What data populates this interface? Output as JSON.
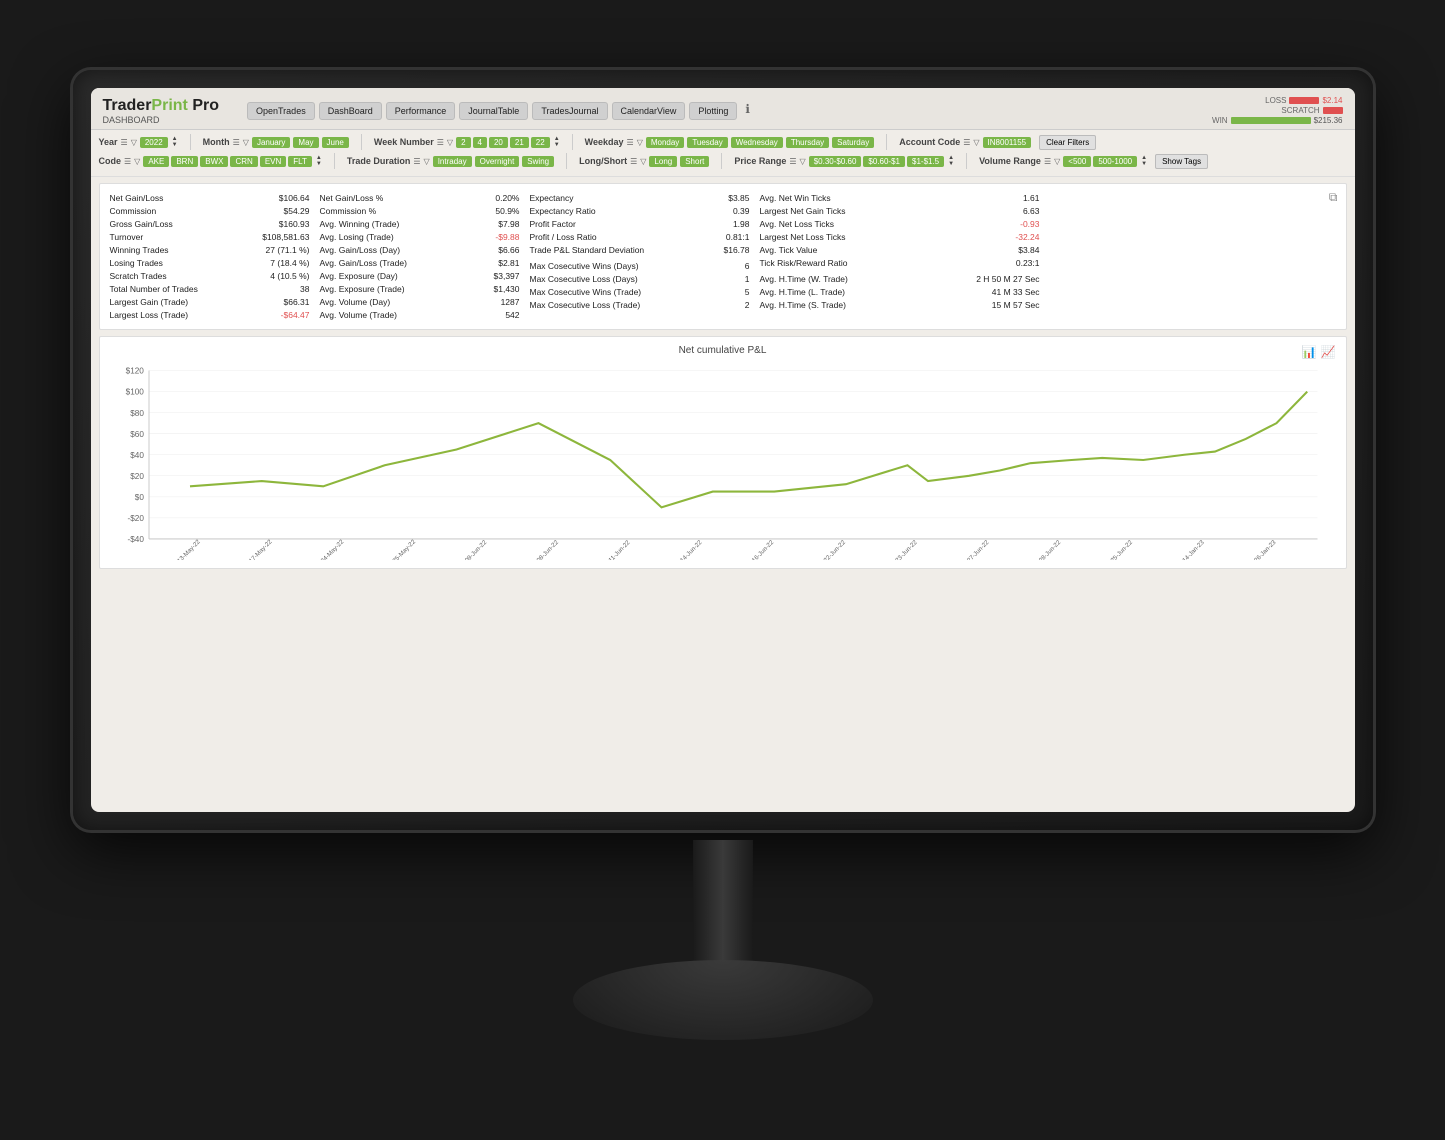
{
  "app": {
    "title": "DASHBOARD",
    "logo": {
      "trader": "Trader",
      "print": "Print",
      "pro": " Pro"
    }
  },
  "nav": {
    "buttons": [
      "OpenTrades",
      "DashBoard",
      "Performance",
      "JournalTable",
      "TradesJournal",
      "CalendarView",
      "Plotting"
    ]
  },
  "lsw": {
    "loss_label": "LOSS",
    "scratch_label": "SCRATCH",
    "win_label": "WIN",
    "loss_value": "$2.14",
    "win_value": "$215.36"
  },
  "filters": {
    "year_label": "Year",
    "year_value": "2022",
    "month_label": "Month",
    "months": [
      "January",
      "May",
      "June"
    ],
    "week_label": "Week Number",
    "weeks": [
      "2",
      "4",
      "20",
      "21",
      "22"
    ],
    "weekday_label": "Weekday",
    "weekdays": [
      "Monday",
      "Tuesday",
      "Wednesday",
      "Thursday",
      "Saturday"
    ],
    "account_label": "Account Code",
    "account_value": "IN8001155",
    "clear_label": "Clear Filters",
    "code_label": "Code",
    "codes": [
      "AKE",
      "BRN",
      "BWX",
      "CRN",
      "EVN",
      "FLT"
    ],
    "trade_duration_label": "Trade Duration",
    "durations": [
      "Intraday",
      "Overnight",
      "Swing"
    ],
    "long_short_label": "Long/Short",
    "directions": [
      "Long",
      "Short"
    ],
    "price_range_label": "Price Range",
    "price_ranges": [
      "$0.30-$0.60",
      "$0.60-$1",
      "$1-$1.5"
    ],
    "volume_range_label": "Volume Range",
    "volumes": [
      "<500",
      "500-1000"
    ],
    "show_tags_label": "Show Tags"
  },
  "stats": {
    "col1": [
      {
        "label": "Net Gain/Loss",
        "value": "$106.64",
        "red": false
      },
      {
        "label": "Commission",
        "value": "$54.29",
        "red": false
      },
      {
        "label": "Gross Gain/Loss",
        "value": "$160.93",
        "red": false
      },
      {
        "label": "Turnover",
        "value": "$108,581.63",
        "red": false
      },
      {
        "label": "Winning Trades",
        "value": "27 (71.1 %)",
        "red": false
      },
      {
        "label": "Losing Trades",
        "value": "7 (18.4 %)",
        "red": false
      },
      {
        "label": "Scratch Trades",
        "value": "4 (10.5 %)",
        "red": false
      },
      {
        "label": "Total Number of Trades",
        "value": "38",
        "red": false
      },
      {
        "label": "Largest Gain (Trade)",
        "value": "$66.31",
        "red": false
      },
      {
        "label": "Largest Loss (Trade)",
        "value": "-$64.47",
        "red": true
      }
    ],
    "col2": [
      {
        "label": "Net Gain/Loss %",
        "value": "0.20%",
        "red": false
      },
      {
        "label": "Commission %",
        "value": "50.9%",
        "red": false
      },
      {
        "label": "Avg. Winning (Trade)",
        "value": "$7.98",
        "red": false
      },
      {
        "label": "Avg. Losing (Trade)",
        "value": "-$9.88",
        "red": true
      },
      {
        "label": "Avg. Gain/Loss (Day)",
        "value": "$6.66",
        "red": false
      },
      {
        "label": "Avg. Gain/Loss (Trade)",
        "value": "$2.81",
        "red": false
      },
      {
        "label": "Avg. Exposure (Day)",
        "value": "$3,397",
        "red": false
      },
      {
        "label": "Avg. Exposure (Trade)",
        "value": "$1,430",
        "red": false
      },
      {
        "label": "Avg. Volume (Day)",
        "value": "1287",
        "red": false
      },
      {
        "label": "Avg. Volume (Trade)",
        "value": "542",
        "red": false
      }
    ],
    "col3": [
      {
        "label": "Expectancy",
        "value": "$3.85",
        "red": false
      },
      {
        "label": "Expectancy Ratio",
        "value": "0.39",
        "red": false
      },
      {
        "label": "Profit Factor",
        "value": "1.98",
        "red": false
      },
      {
        "label": "Profit / Loss Ratio",
        "value": "0.81:1",
        "red": false
      },
      {
        "label": "Trade P&L Standard Deviation",
        "value": "$16.78",
        "red": false
      },
      {
        "label": "",
        "value": "",
        "red": false
      },
      {
        "label": "Max Cosecutive Wins (Days)",
        "value": "6",
        "red": false
      },
      {
        "label": "Max Cosecutive Loss (Days)",
        "value": "1",
        "red": false
      },
      {
        "label": "Max Cosecutive Wins (Trade)",
        "value": "5",
        "red": false
      },
      {
        "label": "Max Cosecutive Loss (Trade)",
        "value": "2",
        "red": false
      }
    ],
    "col4": [
      {
        "label": "Avg. Net Win Ticks",
        "value": "1.61",
        "red": false
      },
      {
        "label": "Largest Net Gain Ticks",
        "value": "6.63",
        "red": false
      },
      {
        "label": "Avg. Net Loss Ticks",
        "value": "-0.93",
        "red": true
      },
      {
        "label": "Largest Net Loss Ticks",
        "value": "-32.24",
        "red": true
      },
      {
        "label": "Avg. Tick Value",
        "value": "$3.84",
        "red": false
      },
      {
        "label": "Tick Risk/Reward Ratio",
        "value": "0.23:1",
        "red": false
      },
      {
        "label": "",
        "value": "",
        "red": false
      },
      {
        "label": "Avg. H.Time (W. Trade)",
        "value": "2 H 50 M 27 Sec",
        "red": false
      },
      {
        "label": "Avg. H.Time (L. Trade)",
        "value": "41 M 33 Sec",
        "red": false
      },
      {
        "label": "Avg. H.Time (S. Trade)",
        "value": "15 M 57 Sec",
        "red": false
      }
    ]
  },
  "chart": {
    "title": "Net cumulative P&L",
    "y_labels": [
      "$120",
      "$100",
      "$80",
      "$60",
      "$40",
      "$20",
      "$0",
      "-$20",
      "-$40"
    ],
    "x_labels": [
      "13-May-22",
      "17-May-22",
      "24-May-22",
      "25-May-22",
      "09-Jun-22",
      "08-Jun-22",
      "11-Jun-22",
      "14-Jun-22",
      "16-Jun-22",
      "22-Jun-22",
      "23-Jun-22",
      "27-Jun-22",
      "28-Jun-22",
      "25-Jun-22",
      "14-Jan-23",
      "26-Jan-23"
    ],
    "line_color": "#8db63c"
  }
}
